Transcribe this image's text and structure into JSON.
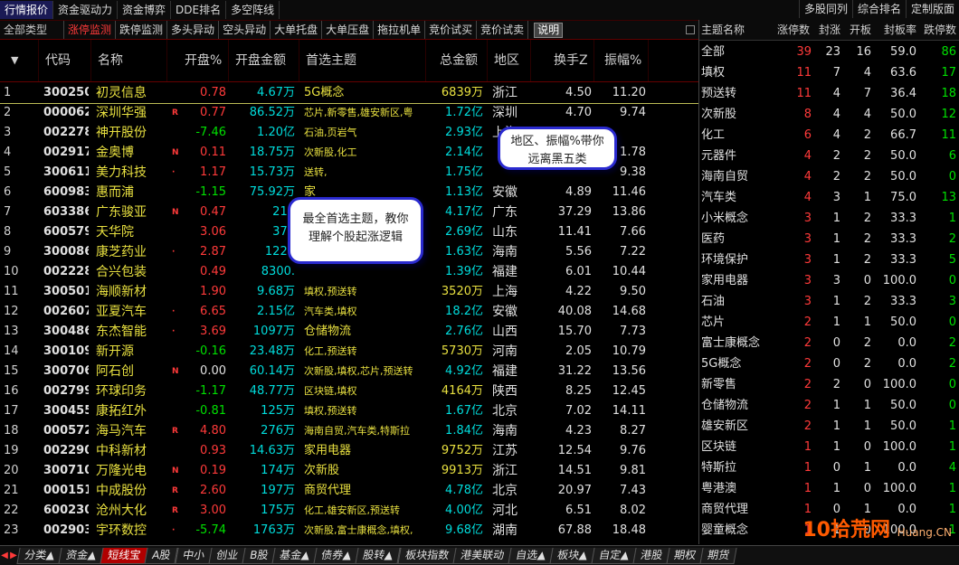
{
  "top_tabs": [
    "行情报价",
    "资金驱动力",
    "资金博弈",
    "DDE排名",
    "多空阵线"
  ],
  "top_right_tabs": [
    "多股同列",
    "综合排名",
    "定制版面"
  ],
  "sub_tabs": [
    "全部类型",
    "涨停监测",
    "跌停监测",
    "多头异动",
    "空头异动",
    "大单托盘",
    "大单压盘",
    "拖拉机单",
    "竞价试买",
    "竞价试卖"
  ],
  "explain_label": "说明",
  "table_headers": {
    "code": "代码",
    "name": "名称",
    "open_pct": "开盘%",
    "open_amt": "开盘金额",
    "theme": "首选主题",
    "total_amt": "总金额",
    "area": "地区",
    "turnover": "换手Z",
    "amplitude": "振幅%"
  },
  "rows": [
    {
      "idx": "1",
      "code": "300250",
      "name": "初灵信息",
      "flag": "",
      "open": "0.78",
      "open_c": "red",
      "amt": "4.67万",
      "theme": "5G概念",
      "theme_big": true,
      "tot": "6839万",
      "tot_c": "yellow",
      "area": "浙江",
      "turn": "4.50",
      "amp": "11.20"
    },
    {
      "idx": "2",
      "code": "000062",
      "name": "深圳华强",
      "flag": "R",
      "open": "0.77",
      "open_c": "red",
      "amt": "86.52万",
      "theme": "芯片,新零售,雄安新区,粤",
      "theme_big": false,
      "tot": "1.72亿",
      "tot_c": "cyan",
      "area": "深圳",
      "turn": "4.70",
      "amp": "9.74"
    },
    {
      "idx": "3",
      "code": "002278",
      "name": "神开股份",
      "flag": "",
      "open": "-7.46",
      "open_c": "green",
      "amt": "1.20亿",
      "theme": "石油,页岩气",
      "theme_big": false,
      "tot": "2.93亿",
      "tot_c": "cyan",
      "area": "上海",
      "turn": "",
      "amp": ""
    },
    {
      "idx": "4",
      "code": "002917",
      "name": "金奥博",
      "flag": "N",
      "open": "0.11",
      "open_c": "red",
      "amt": "18.75万",
      "theme": "次新股,化工",
      "theme_big": false,
      "tot": "2.14亿",
      "tot_c": "cyan",
      "area": "",
      "turn": "",
      "amp": "1.78"
    },
    {
      "idx": "5",
      "code": "300611",
      "name": "美力科技",
      "flag": "·",
      "open": "1.17",
      "open_c": "red",
      "amt": "15.73万",
      "theme": "送转,",
      "theme_big": false,
      "tot": "1.75亿",
      "tot_c": "cyan",
      "area": "",
      "turn": "",
      "amp": "9.38"
    },
    {
      "idx": "6",
      "code": "600983",
      "name": "惠而浦",
      "flag": "",
      "open": "-1.15",
      "open_c": "green",
      "amt": "75.92万",
      "theme": "家",
      "theme_big": true,
      "tot": "1.13亿",
      "tot_c": "cyan",
      "area": "安徽",
      "turn": "4.89",
      "amp": "11.46"
    },
    {
      "idx": "7",
      "code": "603386",
      "name": "广东骏亚",
      "flag": "N",
      "open": "0.47",
      "open_c": "red",
      "amt": "219",
      "theme": "",
      "theme_big": false,
      "tot": "4.17亿",
      "tot_c": "cyan",
      "area": "广东",
      "turn": "37.29",
      "amp": "13.86"
    },
    {
      "idx": "8",
      "code": "600579",
      "name": "天华院",
      "flag": "",
      "open": "3.06",
      "open_c": "red",
      "amt": "372",
      "theme": "",
      "theme_big": false,
      "tot": "2.69亿",
      "tot_c": "cyan",
      "area": "山东",
      "turn": "11.41",
      "amp": "7.66"
    },
    {
      "idx": "9",
      "code": "300086",
      "name": "康芝药业",
      "flag": "·",
      "open": "2.87",
      "open_c": "red",
      "amt": "1223",
      "theme": "",
      "theme_big": false,
      "tot": "1.63亿",
      "tot_c": "cyan",
      "area": "海南",
      "turn": "5.56",
      "amp": "7.22"
    },
    {
      "idx": "10",
      "code": "002228",
      "name": "合兴包装",
      "flag": "",
      "open": "0.49",
      "open_c": "red",
      "amt": "8300.",
      "theme": "",
      "theme_big": false,
      "tot": "1.39亿",
      "tot_c": "cyan",
      "area": "福建",
      "turn": "6.01",
      "amp": "10.44"
    },
    {
      "idx": "11",
      "code": "300501",
      "name": "海顺新材",
      "flag": "",
      "open": "1.90",
      "open_c": "red",
      "amt": "9.68万",
      "theme": "填权,预送转",
      "theme_big": false,
      "tot": "3520万",
      "tot_c": "yellow",
      "area": "上海",
      "turn": "4.22",
      "amp": "9.50"
    },
    {
      "idx": "12",
      "code": "002607",
      "name": "亚夏汽车",
      "flag": "·",
      "open": "6.65",
      "open_c": "red",
      "amt": "2.15亿",
      "theme": "汽车类,填权",
      "theme_big": false,
      "tot": "18.2亿",
      "tot_c": "cyan",
      "area": "安徽",
      "turn": "40.08",
      "amp": "14.68"
    },
    {
      "idx": "13",
      "code": "300486",
      "name": "东杰智能",
      "flag": "·",
      "open": "3.69",
      "open_c": "red",
      "amt": "1097万",
      "theme": "仓储物流",
      "theme_big": true,
      "tot": "2.76亿",
      "tot_c": "cyan",
      "area": "山西",
      "turn": "15.70",
      "amp": "7.73"
    },
    {
      "idx": "14",
      "code": "300109",
      "name": "新开源",
      "flag": "",
      "open": "-0.16",
      "open_c": "green",
      "amt": "23.48万",
      "theme": "化工,预送转",
      "theme_big": false,
      "tot": "5730万",
      "tot_c": "yellow",
      "area": "河南",
      "turn": "2.05",
      "amp": "10.79"
    },
    {
      "idx": "15",
      "code": "300706",
      "name": "阿石创",
      "flag": "N",
      "open": "0.00",
      "open_c": "white",
      "amt": "60.14万",
      "theme": "次新股,填权,芯片,预送转",
      "theme_big": false,
      "tot": "4.92亿",
      "tot_c": "cyan",
      "area": "福建",
      "turn": "31.22",
      "amp": "13.56"
    },
    {
      "idx": "16",
      "code": "002799",
      "name": "环球印务",
      "flag": "",
      "open": "-1.17",
      "open_c": "green",
      "amt": "48.77万",
      "theme": "区块链,填权",
      "theme_big": false,
      "tot": "4164万",
      "tot_c": "yellow",
      "area": "陕西",
      "turn": "8.25",
      "amp": "12.45"
    },
    {
      "idx": "17",
      "code": "300455",
      "name": "康拓红外",
      "flag": "",
      "open": "-0.81",
      "open_c": "green",
      "amt": "125万",
      "theme": "填权,预送转",
      "theme_big": false,
      "tot": "1.67亿",
      "tot_c": "cyan",
      "area": "北京",
      "turn": "7.02",
      "amp": "14.11"
    },
    {
      "idx": "18",
      "code": "000572",
      "name": "海马汽车",
      "flag": "R",
      "open": "4.80",
      "open_c": "red",
      "amt": "276万",
      "theme": "海南自贸,汽车类,特斯拉",
      "theme_big": false,
      "tot": "1.84亿",
      "tot_c": "cyan",
      "area": "海南",
      "turn": "4.23",
      "amp": "8.27"
    },
    {
      "idx": "19",
      "code": "002290",
      "name": "中科新材",
      "flag": "",
      "open": "0.93",
      "open_c": "red",
      "amt": "14.63万",
      "theme": "家用电器",
      "theme_big": true,
      "tot": "9752万",
      "tot_c": "yellow",
      "area": "江苏",
      "turn": "12.54",
      "amp": "9.76"
    },
    {
      "idx": "20",
      "code": "300710",
      "name": "万隆光电",
      "flag": "N",
      "open": "0.19",
      "open_c": "red",
      "amt": "174万",
      "theme": "次新股",
      "theme_big": true,
      "tot": "9913万",
      "tot_c": "yellow",
      "area": "浙江",
      "turn": "14.51",
      "amp": "9.81"
    },
    {
      "idx": "21",
      "code": "000151",
      "name": "中成股份",
      "flag": "R",
      "open": "2.60",
      "open_c": "red",
      "amt": "197万",
      "theme": "商贸代理",
      "theme_big": true,
      "tot": "4.78亿",
      "tot_c": "cyan",
      "area": "北京",
      "turn": "20.97",
      "amp": "7.43"
    },
    {
      "idx": "22",
      "code": "600230",
      "name": "沧州大化",
      "flag": "R",
      "open": "3.00",
      "open_c": "red",
      "amt": "175万",
      "theme": "化工,雄安新区,预送转",
      "theme_big": false,
      "tot": "4.00亿",
      "tot_c": "cyan",
      "area": "河北",
      "turn": "6.51",
      "amp": "8.02"
    },
    {
      "idx": "23",
      "code": "002903",
      "name": "宇环数控",
      "flag": "·",
      "open": "-5.74",
      "open_c": "green",
      "amt": "1763万",
      "theme": "次新股,富士康概念,填权,",
      "theme_big": false,
      "tot": "9.68亿",
      "tot_c": "cyan",
      "area": "湖南",
      "turn": "67.88",
      "amp": "18.48"
    }
  ],
  "right_headers": {
    "name": "主题名称",
    "a": "涨停数",
    "b": "封涨",
    "c": "开板",
    "d": "封板率",
    "e": "跌停数"
  },
  "right_rows": [
    {
      "name": "全部",
      "a": "39",
      "b": "23",
      "c": "16",
      "d": "59.0",
      "e": "86"
    },
    {
      "name": "填权",
      "a": "11",
      "b": "7",
      "c": "4",
      "d": "63.6",
      "e": "17"
    },
    {
      "name": "预送转",
      "a": "11",
      "b": "4",
      "c": "7",
      "d": "36.4",
      "e": "18"
    },
    {
      "name": "次新股",
      "a": "8",
      "b": "4",
      "c": "4",
      "d": "50.0",
      "e": "12"
    },
    {
      "name": "化工",
      "a": "6",
      "b": "4",
      "c": "2",
      "d": "66.7",
      "e": "11"
    },
    {
      "name": "元器件",
      "a": "4",
      "b": "2",
      "c": "2",
      "d": "50.0",
      "e": "6"
    },
    {
      "name": "海南自贸",
      "a": "4",
      "b": "2",
      "c": "2",
      "d": "50.0",
      "e": "0"
    },
    {
      "name": "汽车类",
      "a": "4",
      "b": "3",
      "c": "1",
      "d": "75.0",
      "e": "13"
    },
    {
      "name": "小米概念",
      "a": "3",
      "b": "1",
      "c": "2",
      "d": "33.3",
      "e": "1"
    },
    {
      "name": "医药",
      "a": "3",
      "b": "1",
      "c": "2",
      "d": "33.3",
      "e": "2"
    },
    {
      "name": "环境保护",
      "a": "3",
      "b": "1",
      "c": "2",
      "d": "33.3",
      "e": "5"
    },
    {
      "name": "家用电器",
      "a": "3",
      "b": "3",
      "c": "0",
      "d": "100.0",
      "e": "0"
    },
    {
      "name": "石油",
      "a": "3",
      "b": "1",
      "c": "2",
      "d": "33.3",
      "e": "3"
    },
    {
      "name": "芯片",
      "a": "2",
      "b": "1",
      "c": "1",
      "d": "50.0",
      "e": "0"
    },
    {
      "name": "富士康概念",
      "a": "2",
      "b": "0",
      "c": "2",
      "d": "0.0",
      "e": "2"
    },
    {
      "name": "5G概念",
      "a": "2",
      "b": "0",
      "c": "2",
      "d": "0.0",
      "e": "2"
    },
    {
      "name": "新零售",
      "a": "2",
      "b": "2",
      "c": "0",
      "d": "100.0",
      "e": "0"
    },
    {
      "name": "仓储物流",
      "a": "2",
      "b": "1",
      "c": "1",
      "d": "50.0",
      "e": "0"
    },
    {
      "name": "雄安新区",
      "a": "2",
      "b": "1",
      "c": "1",
      "d": "50.0",
      "e": "1"
    },
    {
      "name": "区块链",
      "a": "1",
      "b": "1",
      "c": "0",
      "d": "100.0",
      "e": "1"
    },
    {
      "name": "特斯拉",
      "a": "1",
      "b": "0",
      "c": "1",
      "d": "0.0",
      "e": "4"
    },
    {
      "name": "粤港澳",
      "a": "1",
      "b": "1",
      "c": "0",
      "d": "100.0",
      "e": "1"
    },
    {
      "name": "商贸代理",
      "a": "1",
      "b": "0",
      "c": "1",
      "d": "0.0",
      "e": "1"
    },
    {
      "name": "婴童概念",
      "a": "1",
      "b": "1",
      "c": "0",
      "d": "100.0",
      "e": "1"
    }
  ],
  "callouts": {
    "area": "地区、振幅%带你远离黑五类",
    "theme": "最全首选主题，教你理解个股起涨逻辑"
  },
  "bottom_tabs": [
    "分类▲",
    "资金▲",
    "短线宝",
    "A股",
    "中小",
    "创业",
    "B股",
    "基金▲",
    "债券▲",
    "股转▲",
    "板块指数",
    "港美联动",
    "自选▲",
    "板块▲",
    "自定▲",
    "港股",
    "期权",
    "期货"
  ],
  "bottom_active": "短线宝",
  "watermark": {
    "brand": "10拾荒网",
    "site": "Huang.CN"
  },
  "colors": {
    "red": "#ff3a3a",
    "green": "#00e000",
    "yellow": "#e8e040",
    "cyan": "#00dcdc",
    "accent": "#2a2ad0"
  }
}
